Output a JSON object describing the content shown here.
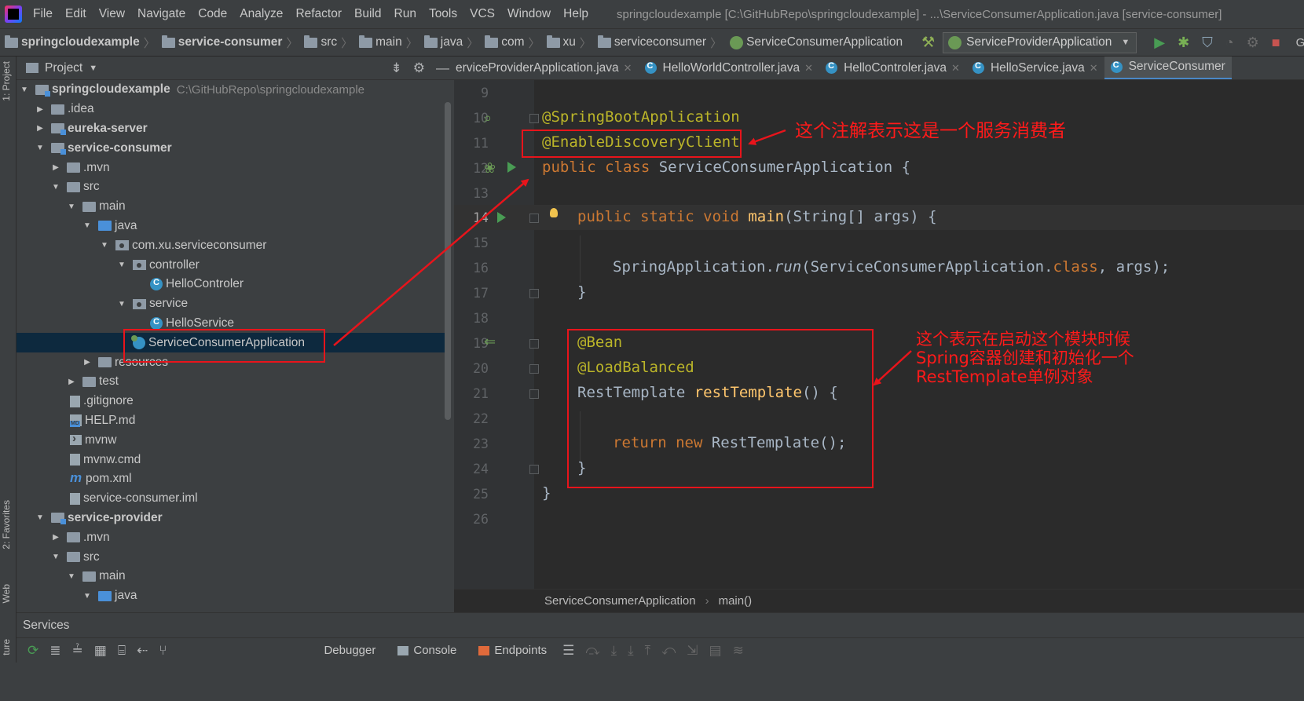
{
  "menubar": {
    "items": [
      "File",
      "Edit",
      "View",
      "Navigate",
      "Code",
      "Analyze",
      "Refactor",
      "Build",
      "Run",
      "Tools",
      "VCS",
      "Window",
      "Help"
    ],
    "title": "springcloudexample [C:\\GitHubRepo\\springcloudexample] - ...\\ServiceConsumerApplication.java [service-consumer]"
  },
  "navbar": {
    "crumbs": [
      "springcloudexample",
      "service-consumer",
      "src",
      "main",
      "java",
      "com",
      "xu",
      "serviceconsumer",
      "ServiceConsumerApplication"
    ],
    "run_config": "ServiceProviderApplication",
    "git_label": "Git"
  },
  "left_stripe": {
    "project_tab": "1: Project",
    "favorites_tab": "2: Favorites",
    "web_tab": "Web",
    "structure_tab": "ture"
  },
  "project_panel": {
    "title": "Project",
    "tree": [
      {
        "label": "springcloudexample",
        "path": "C:\\GitHubRepo\\springcloudexample"
      },
      {
        "label": ".idea"
      },
      {
        "label": "eureka-server"
      },
      {
        "label": "service-consumer"
      },
      {
        "label": ".mvn"
      },
      {
        "label": "src"
      },
      {
        "label": "main"
      },
      {
        "label": "java"
      },
      {
        "label": "com.xu.serviceconsumer"
      },
      {
        "label": "controller"
      },
      {
        "label": "HelloControler"
      },
      {
        "label": "service"
      },
      {
        "label": "HelloService"
      },
      {
        "label": "ServiceConsumerApplication"
      },
      {
        "label": "resources"
      },
      {
        "label": "test"
      },
      {
        "label": ".gitignore"
      },
      {
        "label": "HELP.md"
      },
      {
        "label": "mvnw"
      },
      {
        "label": "mvnw.cmd"
      },
      {
        "label": "pom.xml"
      },
      {
        "label": "service-consumer.iml"
      },
      {
        "label": "service-provider"
      },
      {
        "label": ".mvn"
      },
      {
        "label": "src"
      },
      {
        "label": "main"
      },
      {
        "label": "java"
      }
    ]
  },
  "editor_tabs": [
    "erviceProviderApplication.java",
    "HelloWorldController.java",
    "HelloControler.java",
    "HelloService.java",
    "ServiceConsumer"
  ],
  "editor": {
    "line_numbers": [
      "9",
      "10",
      "11",
      "12",
      "13",
      "14",
      "15",
      "16",
      "17",
      "18",
      "19",
      "20",
      "21",
      "22",
      "23",
      "24",
      "25",
      "26"
    ],
    "code": {
      "l10": "@SpringBootApplication",
      "l11": "@EnableDiscoveryClient",
      "l12_kw": "public class ",
      "l12_rest": "ServiceConsumerApplication {",
      "l14_kw": "public static void ",
      "l14_fn": "main",
      "l14_rest": "(String[] args) {",
      "l16_a": "SpringApplication.",
      "l16_run": "run",
      "l16_b": "(ServiceConsumerApplication.",
      "l16_kw": "class",
      "l16_c": ", args);",
      "l17": "}",
      "l19": "@Bean",
      "l20": "@LoadBalanced",
      "l21_a": "RestTemplate ",
      "l21_fn": "restTemplate",
      "l21_b": "() {",
      "l23_kw": "return new ",
      "l23_rest": "RestTemplate();",
      "l24": "}",
      "l25": "}"
    }
  },
  "editor_breadcrumb": [
    "ServiceConsumerApplication",
    "main()"
  ],
  "services": {
    "title": "Services",
    "tabs": [
      "Debugger",
      "Console",
      "Endpoints"
    ]
  },
  "annotations": {
    "note1": "这个注解表示这是一个服务消费者",
    "note2_lines": [
      "这个表示在启动这个模块时候",
      "Spring容器创建和初始化一个",
      "RestTemplate单例对象"
    ],
    "color": "#e8141b"
  },
  "colors": {
    "background": "#2b2b2b",
    "panel": "#3c3f41",
    "annotation": "#bbb529",
    "keyword": "#cc7832",
    "function": "#ffc66d",
    "text": "#a9b7c6",
    "selection": "#0d293e"
  }
}
